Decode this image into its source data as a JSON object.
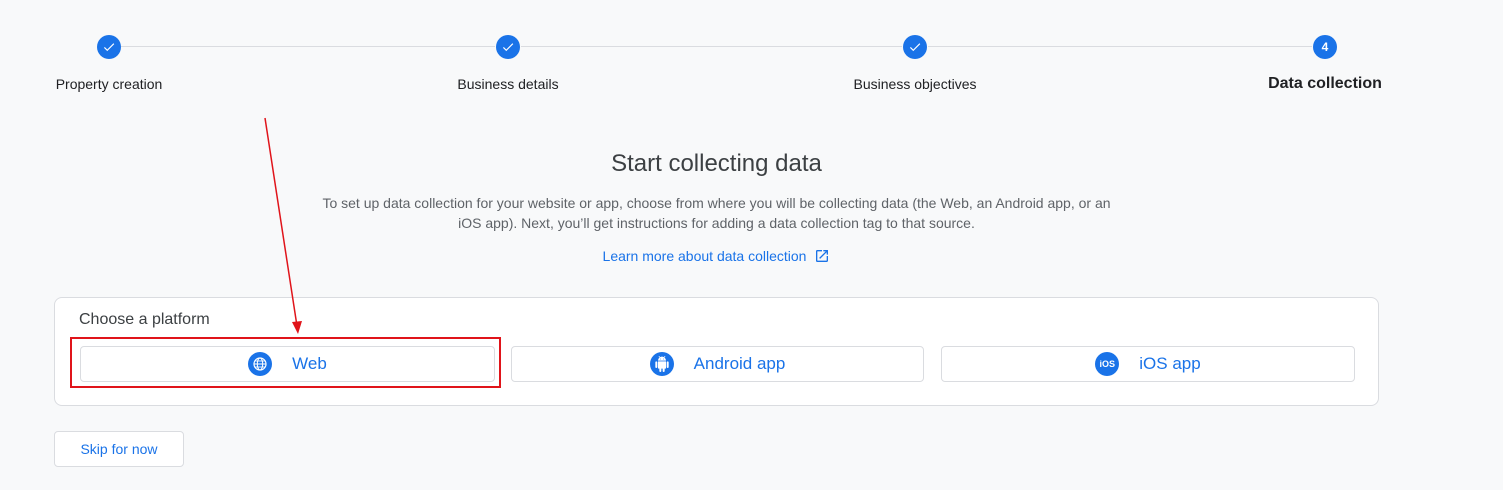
{
  "stepper": {
    "steps": [
      {
        "label": "Property creation",
        "state": "done"
      },
      {
        "label": "Business details",
        "state": "done"
      },
      {
        "label": "Business objectives",
        "state": "done"
      },
      {
        "label": "Data collection",
        "state": "current",
        "number": "4"
      }
    ]
  },
  "main": {
    "title": "Start collecting data",
    "description": "To set up data collection for your website or app, choose from where you will be collecting data (the Web, an Android app, or an iOS app). Next, you’ll get instructions for adding a data collection tag to that source.",
    "learn_more_label": "Learn more about data collection"
  },
  "platform": {
    "title": "Choose a platform",
    "options": [
      {
        "label": "Web",
        "icon": "globe-icon"
      },
      {
        "label": "Android app",
        "icon": "android-icon"
      },
      {
        "label": "iOS app",
        "icon": "ios-icon",
        "icon_text": "iOS"
      }
    ]
  },
  "skip_label": "Skip for now",
  "colors": {
    "accent": "#1a73e8",
    "annotation": "#e0141a",
    "background": "#f8f9fa"
  }
}
